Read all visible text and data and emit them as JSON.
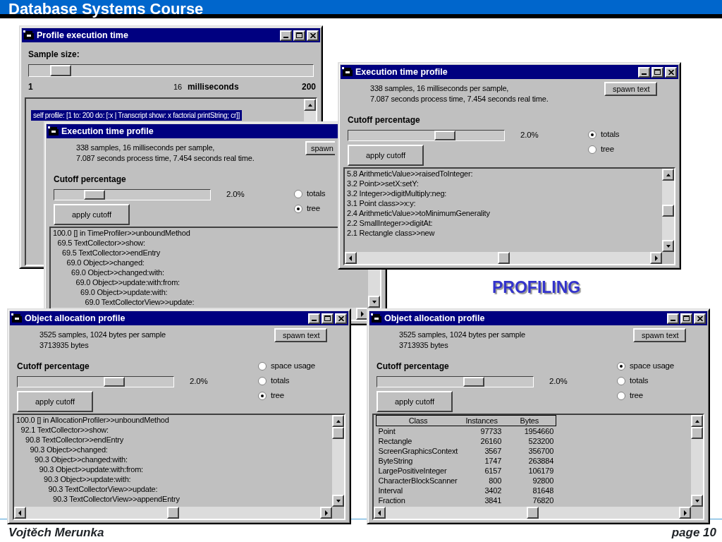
{
  "slide": {
    "title": "Database Systems Course",
    "heading": "PROFILING",
    "author": "Vojtěch Merunka",
    "page": "page 10"
  },
  "windows": [
    {
      "kind": "sampler",
      "title": "Profile execution time",
      "sample_label": "Sample size:",
      "sample_slider": {
        "level": 0.08
      },
      "min": "1",
      "value": "16",
      "unit": "milliseconds",
      "max": "200",
      "code": "self profile: [1 to: 200 do: [:x | Transcript show: x factorial printString; cr]]"
    },
    {
      "kind": "profile",
      "title": "Execution time profile",
      "summary": [
        "338 samples, 16 milliseconds per sample,",
        "7.087 seconds process time, 7.454 seconds real time."
      ],
      "spawn_button": "spawn",
      "cutoff_label": "Cutoff percentage",
      "cutoff": {
        "level": 0.22
      },
      "cutoff_reading": "2.0%",
      "apply_button": "apply cutoff",
      "options": [
        {
          "label": "totals",
          "selected": false
        },
        {
          "label": "tree",
          "selected": true
        }
      ],
      "tree": [
        {
          "text": "100.0 [] in TimeProfiler>>unboundMethod",
          "children": [
            {
              "text": "69.5 TextCollector>>show:",
              "children": [
                {
                  "text": "69.5 TextCollector>>endEntry",
                  "children": [
                    {
                      "text": "69.0 Object>>changed:",
                      "children": [
                        {
                          "text": "69.0 Object>>changed:with:",
                          "children": [
                            {
                              "text": "69.0 Object>>update:with:from:",
                              "children": [
                                {
                                  "text": "69.0 Object>>update:with:",
                                  "children": [
                                    {
                                      "text": "69.0 TextCollectorView>>update:"
                                    }
                                  ]
                                }
                              ]
                            }
                          ]
                        }
                      ]
                    }
                  ]
                }
              ]
            }
          ]
        }
      ]
    },
    {
      "kind": "profile",
      "title": "Execution time profile",
      "summary": [
        "338 samples, 16 milliseconds per sample,",
        "7.087 seconds process time, 7.454 seconds real time."
      ],
      "spawn_button": "spawn text",
      "cutoff_label": "Cutoff percentage",
      "cutoff": {
        "level": 0.64
      },
      "cutoff_reading": "2.0%",
      "apply_button": "apply cutoff",
      "options": [
        {
          "label": "totals",
          "selected": true
        },
        {
          "label": "tree",
          "selected": false
        }
      ],
      "lines": [
        "5.8 ArithmeticValue>>raisedToInteger:",
        "3.2 Point>>setX:setY:",
        "3.2 Integer>>digitMultiply:neg:",
        "3.1 Point class>>x:y:",
        "2.4 ArithmeticValue>>toMinimumGenerality",
        "2.2 SmallInteger>>digitAt:",
        "2.1 Rectangle class>>new"
      ]
    },
    {
      "kind": "profile",
      "title": "Object allocation profile",
      "summary": [
        "3525 samples, 1024 bytes per sample",
        "3713935 bytes"
      ],
      "spawn_button": "spawn text",
      "cutoff_label": "Cutoff percentage",
      "cutoff": {
        "level": 0.64
      },
      "cutoff_reading": "2.0%",
      "apply_button": "apply cutoff",
      "options": [
        {
          "label": "space usage",
          "selected": false
        },
        {
          "label": "totals",
          "selected": false
        },
        {
          "label": "tree",
          "selected": true
        }
      ],
      "tree": [
        {
          "text": "100.0 [] in AllocationProfiler>>unboundMethod",
          "children": [
            {
              "text": "92.1 TextCollector>>show:",
              "children": [
                {
                  "text": "90.8 TextCollector>>endEntry",
                  "children": [
                    {
                      "text": "90.3 Object>>changed:",
                      "children": [
                        {
                          "text": "90.3 Object>>changed:with:",
                          "children": [
                            {
                              "text": "90.3 Object>>update:with:from:",
                              "children": [
                                {
                                  "text": "90.3 Object>>update:with:",
                                  "children": [
                                    {
                                      "text": "90.3 TextCollectorView>>update:",
                                      "children": [
                                        {
                                          "text": "90.3 TextCollectorView>>appendEntry"
                                        }
                                      ]
                                    }
                                  ]
                                }
                              ]
                            }
                          ]
                        }
                      ]
                    }
                  ]
                }
              ]
            }
          ]
        }
      ]
    },
    {
      "kind": "profile",
      "title": "Object allocation profile",
      "summary": [
        "3525 samples, 1024 bytes per sample",
        "3713935 bytes"
      ],
      "spawn_button": "spawn text",
      "cutoff_label": "Cutoff percentage",
      "cutoff": {
        "level": 0.64
      },
      "cutoff_reading": "2.0%",
      "apply_button": "apply cutoff",
      "options": [
        {
          "label": "space usage",
          "selected": true
        },
        {
          "label": "totals",
          "selected": false
        },
        {
          "label": "tree",
          "selected": false
        }
      ],
      "table": {
        "columns": [
          "Class",
          "Instances",
          "Bytes"
        ],
        "rows": [
          [
            "Point",
            "97733",
            "1954660"
          ],
          [
            "Rectangle",
            "26160",
            "523200"
          ],
          [
            "ScreenGraphicsContext",
            "3567",
            "356700"
          ],
          [
            "ByteString",
            "1747",
            "263884"
          ],
          [
            "LargePositiveInteger",
            "6157",
            "106179"
          ],
          [
            "CharacterBlockScanner",
            "800",
            "92800"
          ],
          [
            "Interval",
            "3402",
            "81648"
          ],
          [
            "Fraction",
            "3841",
            "76820"
          ]
        ]
      }
    }
  ]
}
